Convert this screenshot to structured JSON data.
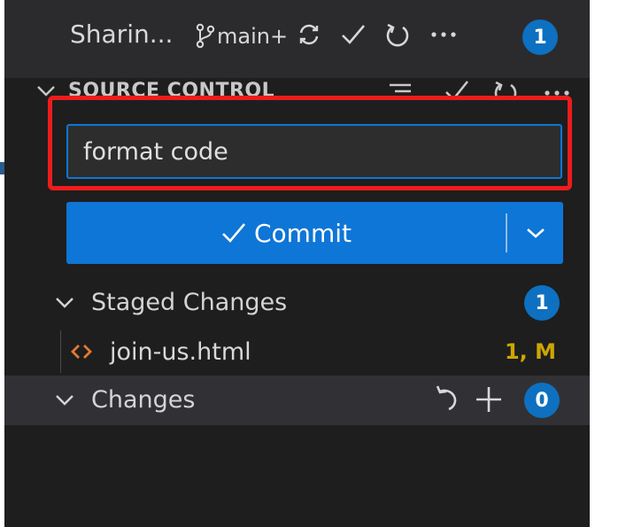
{
  "title_bar": {
    "repo": "Sharin...",
    "branch": "main+",
    "badge": "1",
    "icons": [
      "source-control-branch-icon",
      "sync-icon",
      "check-icon",
      "refresh-icon",
      "more-icon"
    ]
  },
  "source_control": {
    "header": "SOURCE CONTROL",
    "icons": [
      "view-tree-icon",
      "check-icon",
      "refresh-icon",
      "more-icon"
    ]
  },
  "commit": {
    "message_value": "format code",
    "button_label": "Commit"
  },
  "staged": {
    "label": "Staged Changes",
    "badge": "1",
    "files": [
      {
        "name": "join-us.html",
        "status": "1, M"
      }
    ]
  },
  "changes": {
    "label": "Changes",
    "badge": "0"
  },
  "colors": {
    "accent": "#0e76d6",
    "highlight": "#ee1c1c",
    "modified": "#cca700",
    "html_icon": "#e37933"
  }
}
